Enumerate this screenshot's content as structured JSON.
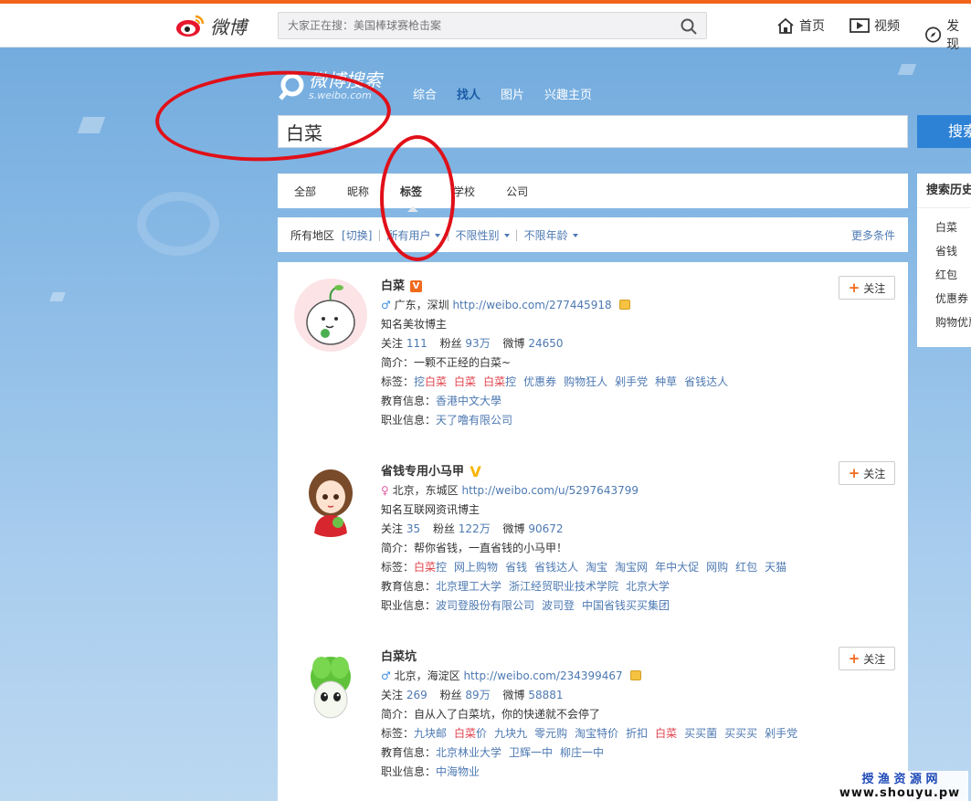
{
  "topbar": {
    "logo_text": "微博",
    "search_placeholder": "大家正在搜：美国棒球赛枪击案",
    "nav": [
      {
        "label": "首页",
        "icon": "home-icon"
      },
      {
        "label": "视频",
        "icon": "video-icon"
      },
      {
        "label": "发现",
        "icon": "compass-icon"
      }
    ]
  },
  "search_header": {
    "logo_title": "微博搜索",
    "logo_sub": "s.weibo.com",
    "tabs": [
      "综合",
      "找人",
      "图片",
      "兴趣主页"
    ],
    "active_tab": "找人",
    "query": "白菜",
    "button": "搜索"
  },
  "type_tabs": [
    "全部",
    "昵称",
    "标签",
    "学校",
    "公司"
  ],
  "active_type": "标签",
  "filters": {
    "region": "所有地区",
    "switch": "[切换]",
    "users": "所有用户",
    "gender": "不限性别",
    "age": "不限年龄",
    "more": "更多条件"
  },
  "follow_label": "关注",
  "users": [
    {
      "name": "白菜",
      "verified": "V",
      "location": "广东，深圳",
      "url": "http://weibo.com/277445918",
      "desc": "知名美妆博主",
      "follow_label": "关注",
      "follow": "111",
      "fans_label": "粉丝",
      "fans": "93万",
      "weibo_label": "微博",
      "weibo": "24650",
      "intro_label": "简介：",
      "intro": "一颗不正经的白菜~",
      "tags_label": "标签：",
      "tags": [
        "挖白菜",
        "白菜",
        "白菜控",
        "优惠券",
        "购物狂人",
        "剁手党",
        "种草",
        "省钱达人"
      ],
      "edu_label": "教育信息：",
      "edu": [
        "香港中文大學"
      ],
      "job_label": "职业信息：",
      "job": [
        "天了噜有限公司"
      ]
    },
    {
      "name": "省钱专用小马甲",
      "verified": "V",
      "location": "北京，东城区",
      "url": "http://weibo.com/u/5297643799",
      "desc": "知名互联网资讯博主",
      "follow_label": "关注",
      "follow": "35",
      "fans_label": "粉丝",
      "fans": "122万",
      "weibo_label": "微博",
      "weibo": "90672",
      "intro_label": "简介：",
      "intro": "帮你省钱，一直省钱的小马甲！",
      "tags_label": "标签：",
      "tags": [
        "白菜控",
        "网上购物",
        "省钱",
        "省钱达人",
        "淘宝",
        "淘宝网",
        "年中大促",
        "网购",
        "红包",
        "天猫"
      ],
      "edu_label": "教育信息：",
      "edu": [
        "北京理工大学",
        "浙江经贸职业技术学院",
        "北京大学"
      ],
      "job_label": "职业信息：",
      "job": [
        "波司登股份有限公司",
        "波司登",
        "中国省钱买买集团"
      ]
    },
    {
      "name": "白菜坑",
      "location": "北京，海淀区",
      "url": "http://weibo.com/234399467",
      "follow_label": "关注",
      "follow": "269",
      "fans_label": "粉丝",
      "fans": "89万",
      "weibo_label": "微博",
      "weibo": "58881",
      "intro_label": "简介：",
      "intro": "自从入了白菜坑，你的快递就不会停了",
      "tags_label": "标签：",
      "tags": [
        "九块邮",
        "白菜价",
        "九块九",
        "零元购",
        "淘宝特价",
        "折扣",
        "白菜",
        "买买菌",
        "买买买",
        "剁手党"
      ],
      "edu_label": "教育信息：",
      "edu": [
        "北京林业大学",
        "卫辉一中",
        "柳庄一中"
      ],
      "job_label": "职业信息：",
      "job": [
        "中海物业"
      ]
    }
  ],
  "history": {
    "title": "搜索历史",
    "items": [
      "白菜",
      "省钱",
      "红包",
      "优惠券",
      "购物优惠"
    ]
  },
  "watermark": {
    "line1": "授 渔 资 源 网",
    "line2": "www.shouyu.pw"
  },
  "colors": {
    "accent_blue": "#4d79b2",
    "tag_red": "#e0414b",
    "annotation_red": "#e01019",
    "search_button": "#2d82d6"
  }
}
